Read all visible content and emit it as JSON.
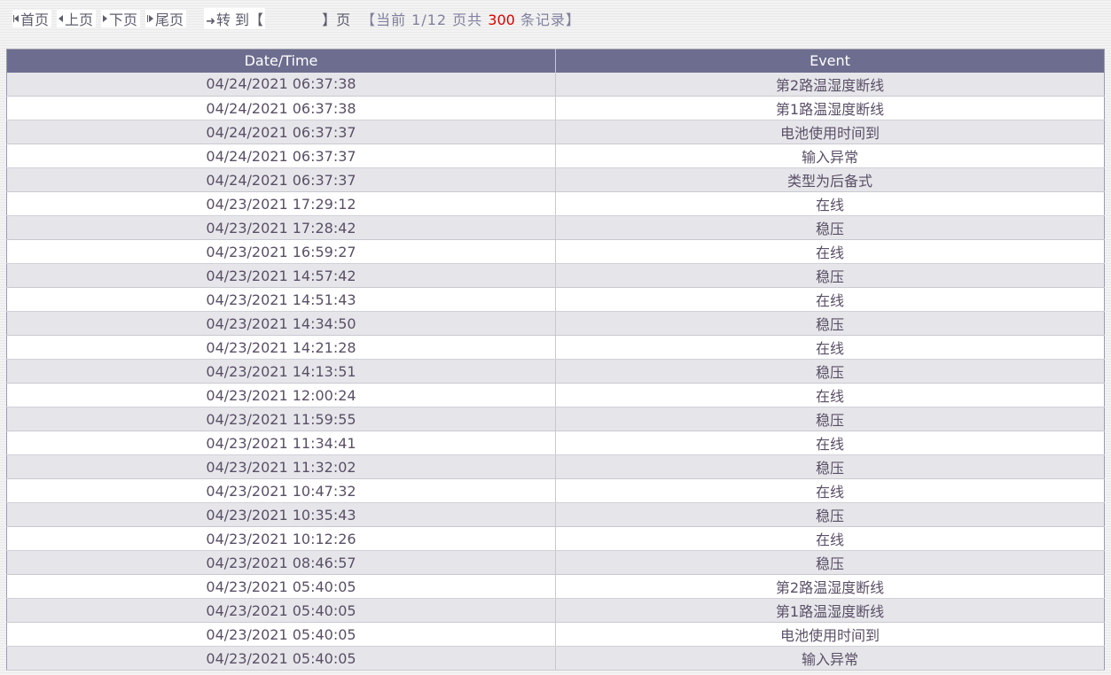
{
  "pager": {
    "first": "首页",
    "prev": "上页",
    "next": "下页",
    "last": "尾页",
    "goto_prefix": "转 到【",
    "goto_value": "",
    "goto_suffix": "】页",
    "status_prefix": "【当前 1/12 页共 ",
    "status_count": "300",
    "status_suffix": " 条记录】"
  },
  "table": {
    "headers": [
      "Date/Time",
      "Event"
    ],
    "rows": [
      {
        "datetime": "04/24/2021 06:37:38",
        "event": "第2路温湿度断线"
      },
      {
        "datetime": "04/24/2021 06:37:38",
        "event": "第1路温湿度断线"
      },
      {
        "datetime": "04/24/2021 06:37:37",
        "event": "电池使用时间到"
      },
      {
        "datetime": "04/24/2021 06:37:37",
        "event": "输入异常"
      },
      {
        "datetime": "04/24/2021 06:37:37",
        "event": "类型为后备式"
      },
      {
        "datetime": "04/23/2021 17:29:12",
        "event": "在线"
      },
      {
        "datetime": "04/23/2021 17:28:42",
        "event": "稳压"
      },
      {
        "datetime": "04/23/2021 16:59:27",
        "event": "在线"
      },
      {
        "datetime": "04/23/2021 14:57:42",
        "event": "稳压"
      },
      {
        "datetime": "04/23/2021 14:51:43",
        "event": "在线"
      },
      {
        "datetime": "04/23/2021 14:34:50",
        "event": "稳压"
      },
      {
        "datetime": "04/23/2021 14:21:28",
        "event": "在线"
      },
      {
        "datetime": "04/23/2021 14:13:51",
        "event": "稳压"
      },
      {
        "datetime": "04/23/2021 12:00:24",
        "event": "在线"
      },
      {
        "datetime": "04/23/2021 11:59:55",
        "event": "稳压"
      },
      {
        "datetime": "04/23/2021 11:34:41",
        "event": "在线"
      },
      {
        "datetime": "04/23/2021 11:32:02",
        "event": "稳压"
      },
      {
        "datetime": "04/23/2021 10:47:32",
        "event": "在线"
      },
      {
        "datetime": "04/23/2021 10:35:43",
        "event": "稳压"
      },
      {
        "datetime": "04/23/2021 10:12:26",
        "event": "在线"
      },
      {
        "datetime": "04/23/2021 08:46:57",
        "event": "稳压"
      },
      {
        "datetime": "04/23/2021 05:40:05",
        "event": "第2路温湿度断线"
      },
      {
        "datetime": "04/23/2021 05:40:05",
        "event": "第1路温湿度断线"
      },
      {
        "datetime": "04/23/2021 05:40:05",
        "event": "电池使用时间到"
      },
      {
        "datetime": "04/23/2021 05:40:05",
        "event": "输入异常"
      }
    ]
  },
  "colors": {
    "header_bg": "#6d6d8f",
    "row_alt_bg": "#e6e6ea",
    "count_highlight": "#dd0000"
  }
}
